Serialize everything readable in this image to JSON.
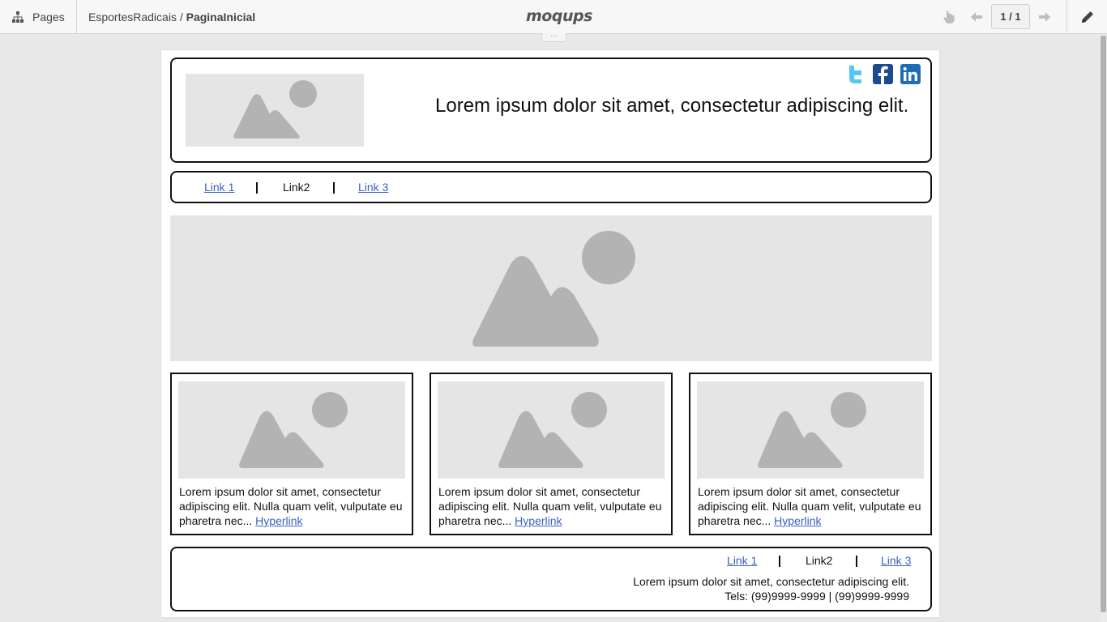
{
  "toolbar": {
    "pages_label": "Pages",
    "breadcrumb_project": "EsportesRadicais",
    "breadcrumb_sep": " / ",
    "breadcrumb_page": "PaginaInicial",
    "logo": "moqups",
    "page_counter": "1 / 1",
    "handle_dots": "···"
  },
  "header": {
    "tagline": "Lorem ipsum dolor sit amet, consectetur adipiscing elit.",
    "social_icons": [
      "twitter-icon",
      "facebook-icon",
      "linkedin-icon"
    ]
  },
  "nav": {
    "links": [
      "Link 1",
      "Link2",
      "Link 3"
    ]
  },
  "cards": [
    {
      "text": "Lorem ipsum dolor sit amet, consectetur adipiscing elit. Nulla quam velit, vulputate eu pharetra nec... ",
      "link": "Hyperlink"
    },
    {
      "text": "Lorem ipsum dolor sit amet, consectetur adipiscing elit. Nulla quam velit, vulputate eu pharetra nec... ",
      "link": "Hyperlink"
    },
    {
      "text": "Lorem ipsum dolor sit amet, consectetur adipiscing elit. Nulla quam velit, vulputate eu pharetra nec... ",
      "link": "Hyperlink"
    }
  ],
  "footer": {
    "links": [
      "Link 1",
      "Link2",
      "Link 3"
    ],
    "line1": "Lorem ipsum dolor sit amet, consectetur adipiscing elit.",
    "line2": "Tels: (99)9999-9999 | (99)9999-9999"
  },
  "colors": {
    "link": "#3b5fc0",
    "twitter": "#55c8f0",
    "facebook": "#1e4a8f",
    "linkedin": "#1f6db5",
    "placeholder_bg": "#e5e5e5",
    "placeholder_shape": "#b3b3b3"
  }
}
